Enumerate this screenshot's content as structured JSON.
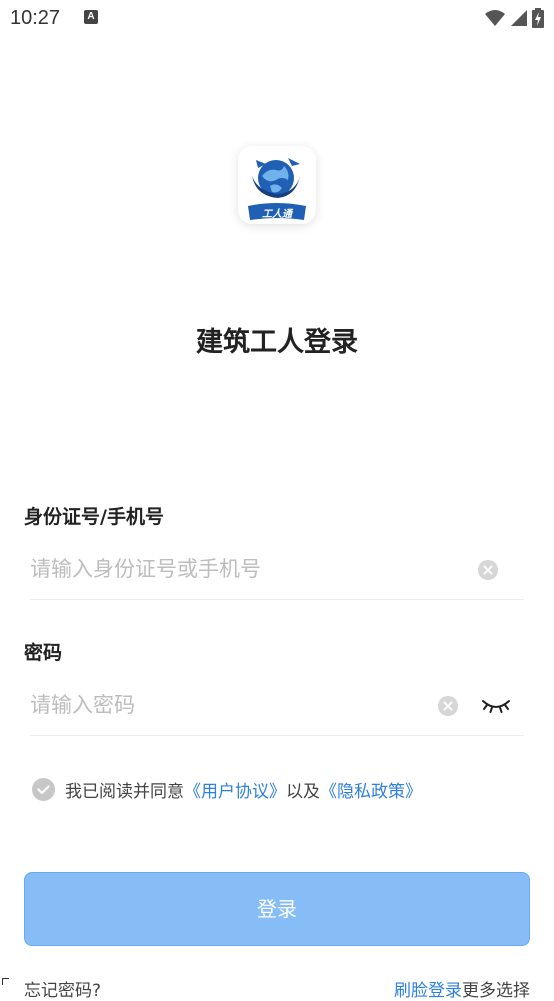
{
  "status_bar": {
    "time": "10:27",
    "notification_icon": "a-notification-icon",
    "wifi_icon": "wifi-icon",
    "signal_icon": "cell-signal-icon",
    "battery_icon": "battery-charging-icon"
  },
  "logo": {
    "text": "工人通",
    "icon": "globe-logo-icon"
  },
  "title": "建筑工人登录",
  "id_field": {
    "label": "身份证号/手机号",
    "placeholder": "请输入身份证号或手机号",
    "value": ""
  },
  "password_field": {
    "label": "密码",
    "placeholder": "请输入密码",
    "value": "",
    "toggle_icon": "eye-closed-icon"
  },
  "agreement": {
    "prefix": "我已阅读并同意",
    "user_agreement": "《用户协议》",
    "middle": "以及",
    "privacy_policy": "《隐私政策》"
  },
  "login_button": "登录",
  "bottom": {
    "forgot_password": "忘记密码?",
    "link_text": "刷脸登录",
    "suffix": "更多选择"
  },
  "colors": {
    "primary_button": "#86bdf7",
    "link": "#2d7fe0",
    "placeholder": "#bdbdbd"
  }
}
